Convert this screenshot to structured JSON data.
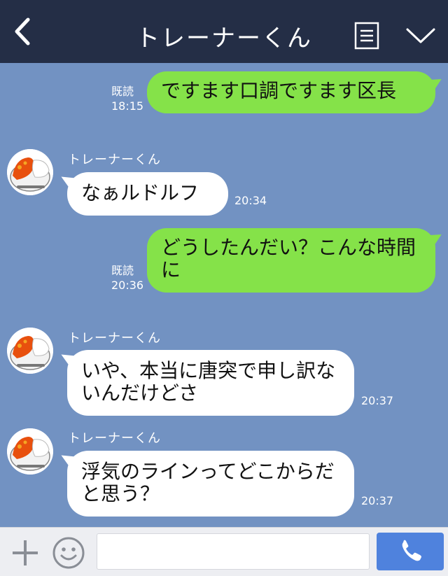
{
  "header": {
    "title": "トレーナーくん",
    "back_icon": "chevron-left-icon",
    "menu_icon": "list-icon",
    "collapse_icon": "chevron-down-icon",
    "background": "#242e46"
  },
  "chat": {
    "background": "#7292c2",
    "messages": [
      {
        "direction": "out",
        "text": "ですます口調ですます区長",
        "read": "既読",
        "time": "18:15"
      },
      {
        "direction": "in",
        "sender": "トレーナーくん",
        "text": "なぁルドルフ",
        "time": "20:34"
      },
      {
        "direction": "out",
        "text": "どうしたんだい？こんな時間に",
        "read": "既読",
        "time": "20:36"
      },
      {
        "direction": "in",
        "sender": "トレーナーくん",
        "text": "いや、本当に唐突で申し訳ないんだけどさ",
        "time": "20:37"
      },
      {
        "direction": "in",
        "sender": "トレーナーくん",
        "text": "浮気のラインってどこからだと思う？",
        "time": "20:37"
      }
    ],
    "outgoing_bubble_color": "#85e249",
    "incoming_bubble_color": "#ffffff"
  },
  "input_bar": {
    "plus_icon": "plus-icon",
    "emoji_icon": "smiley-icon",
    "message_value": "",
    "call_icon": "phone-icon",
    "call_button_color": "#4f82dd"
  }
}
